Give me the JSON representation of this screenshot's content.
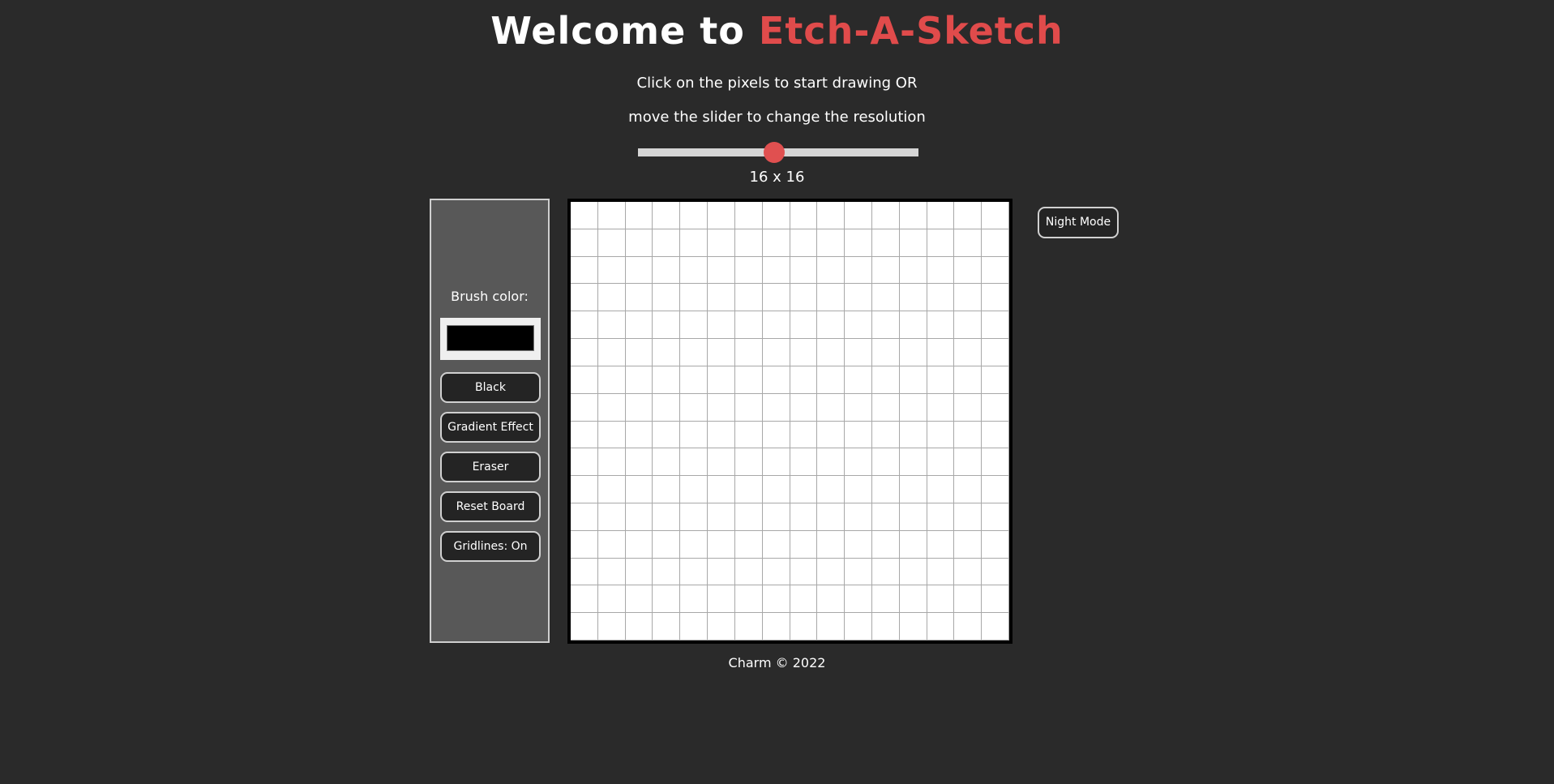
{
  "header": {
    "title_prefix": "Welcome to",
    "title_accent": "Etch-A-Sketch",
    "accent_color": "#e04b4b",
    "instruction_line1": "Click on the pixels to start drawing OR",
    "instruction_line2": "move the slider to change the resolution"
  },
  "resolution": {
    "value": 16,
    "min": 1,
    "max": 100,
    "label": "16 x 16"
  },
  "sidebar": {
    "brush_label": "Brush color:",
    "brush_color": "#000000",
    "buttons": {
      "black": "Black",
      "gradient": "Gradient Effect",
      "eraser": "Eraser",
      "reset": "Reset Board",
      "gridlines": "Gridlines: On"
    }
  },
  "board": {
    "rows": 16,
    "cols": 16,
    "pixel_color": "#ffffff",
    "gridline_color": "#a8a8a8"
  },
  "night_mode_label": "Night Mode",
  "footer": {
    "text": "Charm © 2022"
  }
}
